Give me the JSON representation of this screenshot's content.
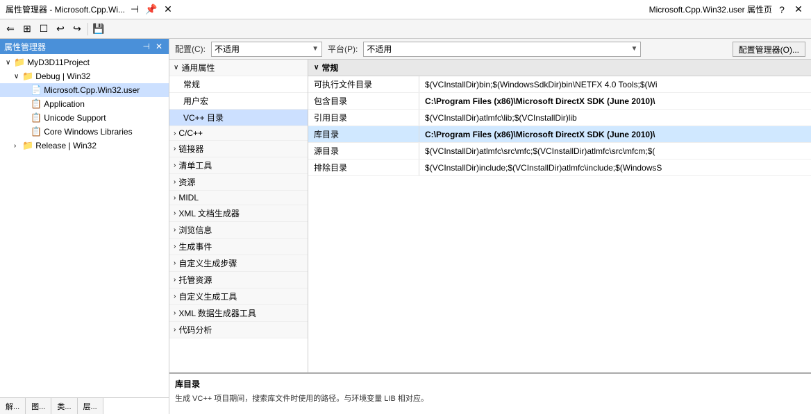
{
  "titleBar": {
    "leftTitle": "属性管理器 - Microsoft.Cpp.Wi...",
    "rightTitle": "Microsoft.Cpp.Win32.user 属性页",
    "dockBtn": "⊣",
    "pinBtn": "📌",
    "closeBtn": "✕",
    "helpBtn": "?",
    "rightCloseBtn": "✕"
  },
  "toolbar": {
    "buttons": [
      "⇐",
      "⊞",
      "☐",
      "↩",
      "↪",
      "💾"
    ]
  },
  "tree": {
    "items": [
      {
        "id": "myD3D11Project",
        "label": "MyD3D11Project",
        "indent": 0,
        "toggle": "∨",
        "icon": "📁",
        "selected": false
      },
      {
        "id": "debugWin32",
        "label": "Debug | Win32",
        "indent": 1,
        "toggle": "∨",
        "icon": "📁",
        "selected": false
      },
      {
        "id": "microsoftCppWin32",
        "label": "Microsoft.Cpp.Win32.user",
        "indent": 2,
        "toggle": "",
        "icon": "📄",
        "selected": true
      },
      {
        "id": "application",
        "label": "Application",
        "indent": 2,
        "toggle": "",
        "icon": "📋",
        "selected": false
      },
      {
        "id": "unicodeSupport",
        "label": "Unicode Support",
        "indent": 2,
        "toggle": "",
        "icon": "📋",
        "selected": false
      },
      {
        "id": "coreWindowsLibs",
        "label": "Core Windows Libraries",
        "indent": 2,
        "toggle": "",
        "icon": "📋",
        "selected": false
      },
      {
        "id": "releaseWin32",
        "label": "Release | Win32",
        "indent": 1,
        "toggle": "›",
        "icon": "📁",
        "selected": false
      }
    ]
  },
  "bottomTabs": [
    {
      "id": "jiě",
      "label": "解..."
    },
    {
      "id": "tú",
      "label": "图..."
    },
    {
      "id": "lèi",
      "label": "类..."
    },
    {
      "id": "céng",
      "label": "层..."
    }
  ],
  "configBar": {
    "configLabel": "配置(C):",
    "configValue": "不适用",
    "platformLabel": "平台(P):",
    "platformValue": "不适用",
    "managerBtn": "配置管理器(O)..."
  },
  "propsHeader": "Microsoft.Cpp.Win32.user 属性页",
  "leftCategories": [
    {
      "id": "commonProps",
      "label": "通用属性",
      "toggle": "∨",
      "expanded": true,
      "selected": false
    },
    {
      "id": "normal",
      "label": "常规",
      "indent": true,
      "selected": false
    },
    {
      "id": "userMacros",
      "label": "用户宏",
      "indent": true,
      "selected": false
    },
    {
      "id": "vcppDirs",
      "label": "VC++ 目录",
      "indent": true,
      "selected": true
    },
    {
      "id": "cpp",
      "label": "C/C++",
      "toggle": "›",
      "expanded": false,
      "selected": false
    },
    {
      "id": "linker",
      "label": "链接器",
      "toggle": "›",
      "expanded": false,
      "selected": false
    },
    {
      "id": "manifest",
      "label": "清单工具",
      "toggle": "›",
      "expanded": false,
      "selected": false
    },
    {
      "id": "resources",
      "label": "资源",
      "toggle": "›",
      "expanded": false,
      "selected": false
    },
    {
      "id": "midl",
      "label": "MIDL",
      "toggle": "›",
      "expanded": false,
      "selected": false
    },
    {
      "id": "xmlDoc",
      "label": "XML 文档生成器",
      "toggle": "›",
      "expanded": false,
      "selected": false
    },
    {
      "id": "browse",
      "label": "浏览信息",
      "toggle": "›",
      "expanded": false,
      "selected": false
    },
    {
      "id": "buildEvents",
      "label": "生成事件",
      "toggle": "›",
      "expanded": false,
      "selected": false
    },
    {
      "id": "customBuild",
      "label": "自定义生成步骤",
      "toggle": "›",
      "expanded": false,
      "selected": false
    },
    {
      "id": "managedRes",
      "label": "托管资源",
      "toggle": "›",
      "expanded": false,
      "selected": false
    },
    {
      "id": "customBuildTool",
      "label": "自定义生成工具",
      "toggle": "›",
      "expanded": false,
      "selected": false
    },
    {
      "id": "xmlDataGen",
      "label": "XML 数据生成器工具",
      "toggle": "›",
      "expanded": false,
      "selected": false
    },
    {
      "id": "codeAnalysis",
      "label": "代码分析",
      "toggle": "›",
      "expanded": false,
      "selected": false
    }
  ],
  "propsTable": {
    "sectionHeader": "常规",
    "rows": [
      {
        "name": "可执行文件目录",
        "value": "$(VCInstallDir)bin;$(WindowsSdkDir)bin\\NETFX 4.0 Tools;$(Wi",
        "bold": false,
        "highlighted": false
      },
      {
        "name": "包含目录",
        "value": "C:\\Program Files (x86)\\Microsoft DirectX SDK (June 2010)\\",
        "bold": true,
        "highlighted": false
      },
      {
        "name": "引用目录",
        "value": "$(VCInstallDir)atlmfc\\lib;$(VCInstallDir)lib",
        "bold": false,
        "highlighted": false
      },
      {
        "name": "库目录",
        "value": "C:\\Program Files (x86)\\Microsoft DirectX SDK (June 2010)\\",
        "bold": true,
        "highlighted": true
      },
      {
        "name": "源目录",
        "value": "$(VCInstallDir)atlmfc\\src\\mfc;$(VCInstallDir)atlmfc\\src\\mfcm;$(",
        "bold": false,
        "highlighted": false
      },
      {
        "name": "排除目录",
        "value": "$(VCInstallDir)include;$(VCInstallDir)atlmfc\\include;$(WindowsS",
        "bold": false,
        "highlighted": false
      }
    ]
  },
  "description": {
    "title": "库目录",
    "text": "生成 VC++ 项目期间，搜索库文件时使用的路径。与环境变量 LIB 相对应。"
  }
}
